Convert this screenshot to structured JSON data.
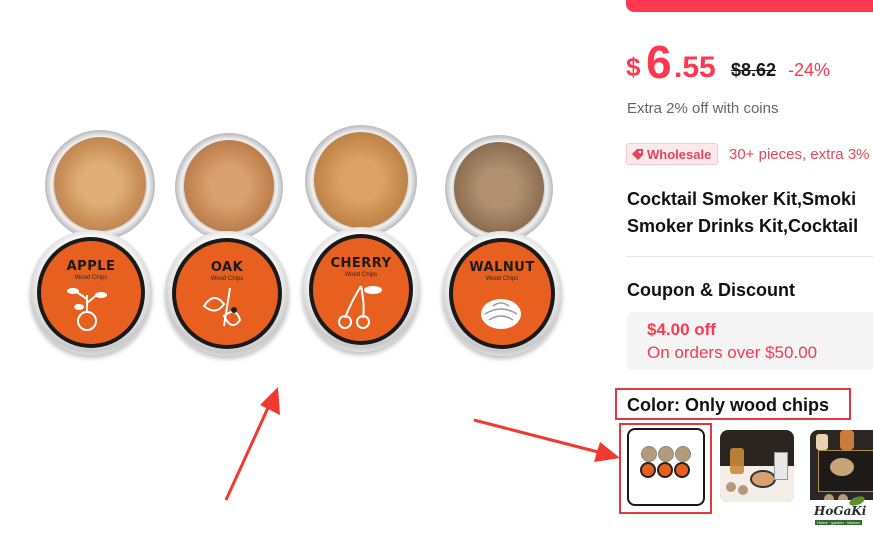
{
  "product_image": {
    "tins": [
      {
        "name": "APPLE",
        "sub": "Wood Chips",
        "chip_color": "#d19a63"
      },
      {
        "name": "OAK",
        "sub": "Wood Chips",
        "chip_color": "#c98a5a"
      },
      {
        "name": "CHERRY",
        "sub": "Wood Chips",
        "chip_color": "#c4884c"
      },
      {
        "name": "WALNUT",
        "sub": "Wood Chips",
        "chip_color": "#9c7e5e"
      }
    ]
  },
  "price": {
    "currency": "$",
    "integer": "6",
    "decimal": ".55",
    "original": "$8.62",
    "discount": "-24%",
    "coins_note": "Extra 2% off with coins"
  },
  "wholesale": {
    "badge_label": "Wholesale",
    "text": "30+ pieces, extra 3%"
  },
  "product": {
    "title_line1": "Cocktail Smoker Kit,Smoki",
    "title_line2": "Smoker Drinks Kit,Cocktail"
  },
  "coupon": {
    "heading": "Coupon & Discount",
    "amount": "$4.00 off",
    "condition": "On orders over $50.00"
  },
  "color": {
    "label": "Color: Only wood chips"
  },
  "thumbnails": [
    {
      "id": "thumb-wood-chips",
      "selected": true
    },
    {
      "id": "thumb-kit-gift",
      "selected": false
    },
    {
      "id": "thumb-kit-box",
      "selected": false
    }
  ],
  "watermark": {
    "brand": "HoGaKi",
    "tagline": "Home · garden · kitchen"
  },
  "colors": {
    "accent": "#fd384f",
    "annotation_red": "#e0393e",
    "label_orange": "#e8601f"
  }
}
